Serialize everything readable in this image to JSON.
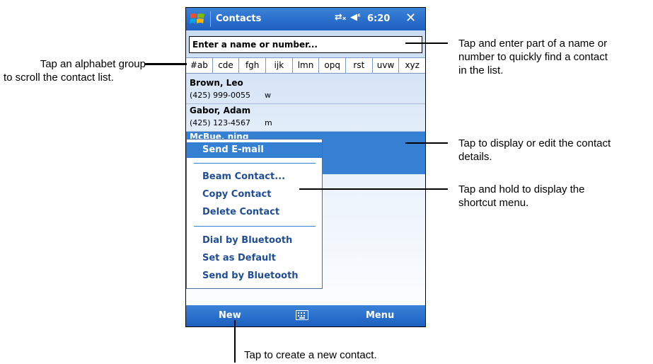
{
  "statusbar": {
    "app_title": "Contacts",
    "clock": "6:20",
    "close": "✕",
    "connectivity_icon": "connectivity-icon",
    "volume_icon": "speaker-icon"
  },
  "search": {
    "placeholder": "Enter a name or number..."
  },
  "alpha_tabs": [
    "#ab",
    "cde",
    "fgh",
    "ijk",
    "lmn",
    "opq",
    "rst",
    "uvw",
    "xyz"
  ],
  "contacts": [
    {
      "name": "Brown, Leo",
      "number": "(425) 999-0055",
      "type": "w"
    },
    {
      "name": "Gabor, Adam",
      "number": "(425) 123-4567",
      "type": "m"
    },
    {
      "name": "McBue, ning",
      "number": "",
      "type": ""
    }
  ],
  "context_menu": {
    "send_email": "Send E-mail",
    "beam_contact": "Beam Contact...",
    "copy_contact": "Copy Contact",
    "delete_contact": "Delete Contact",
    "dial_bluetooth": "Dial by Bluetooth",
    "set_default": "Set as Default",
    "send_bluetooth": "Send by Bluetooth"
  },
  "softkeys": {
    "left": "New",
    "right": "Menu",
    "center_icon": "keyboard-icon"
  },
  "callouts": {
    "alphabet_line1": "Tap an alphabet group",
    "alphabet_line2": "to scroll the contact list.",
    "search_line1": "Tap and enter part of a name or",
    "search_line2": "number to quickly find a contact",
    "search_line3": "in the list.",
    "details_line1": "Tap to display or edit the contact",
    "details_line2": "details.",
    "hold_line1": "Tap and hold to display the",
    "hold_line2": "shortcut menu.",
    "new_contact": "Tap to create a new contact."
  },
  "colors": {
    "titlebar": "#1d5fc0",
    "selection": "#3680d4",
    "menu_text": "#1f4e96"
  }
}
